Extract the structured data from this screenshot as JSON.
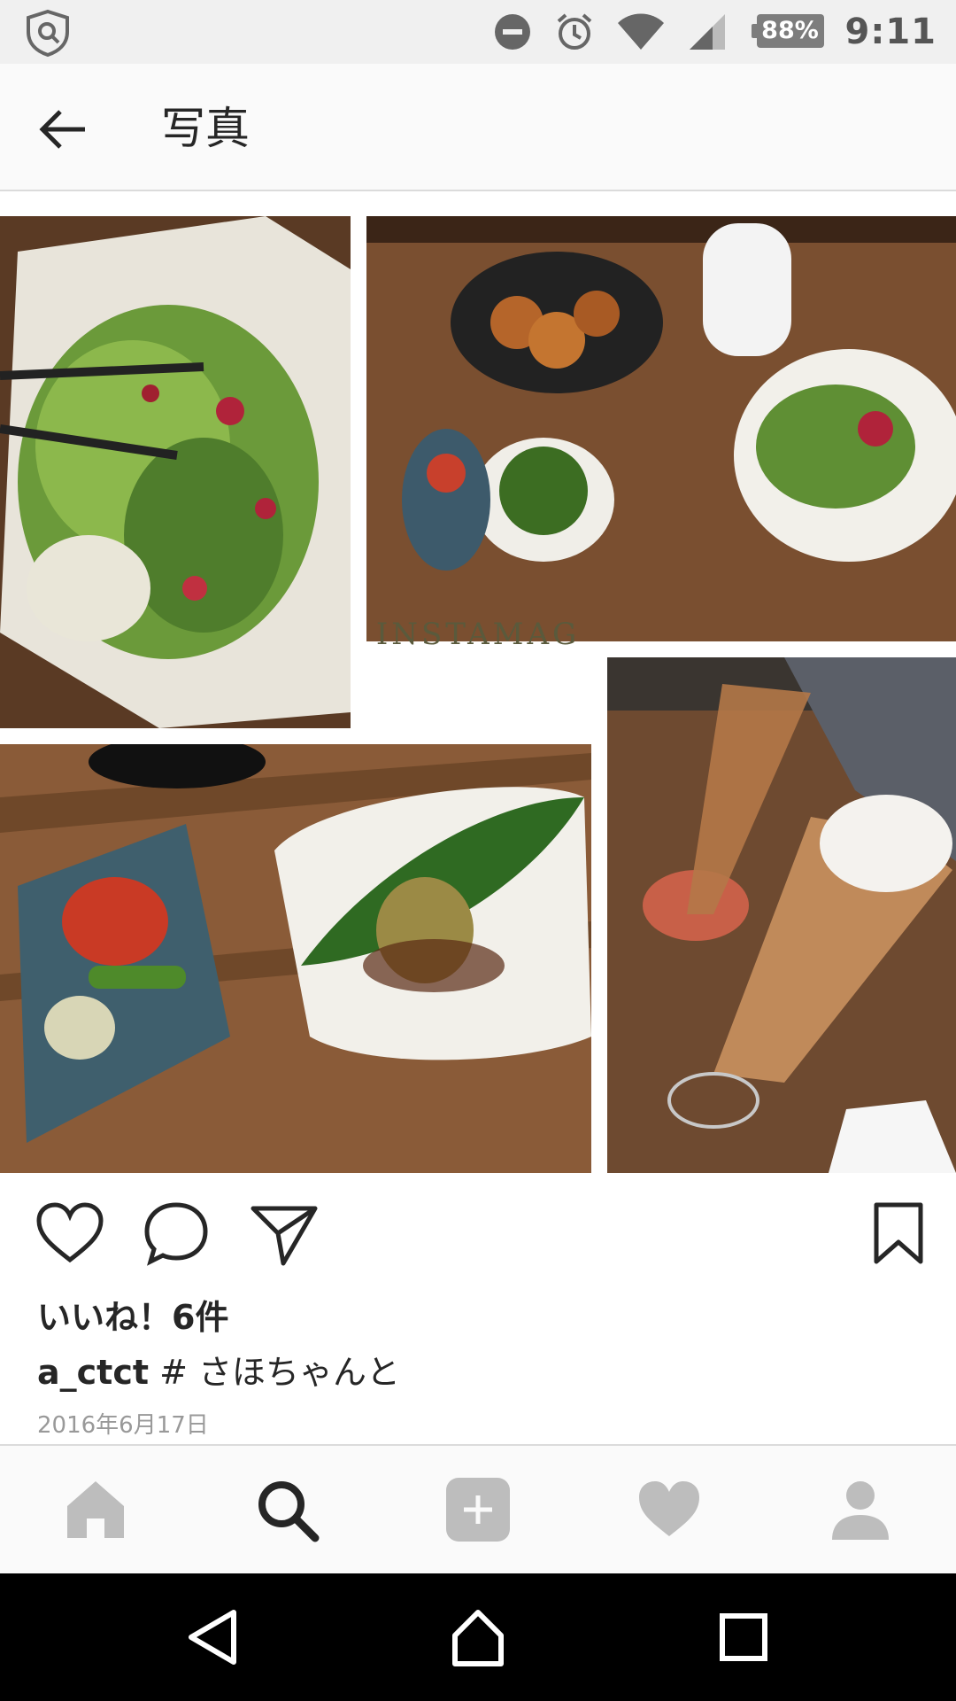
{
  "status_bar": {
    "battery": "88%",
    "time": "9:11",
    "icons": [
      "shield-icon",
      "do-not-disturb-icon",
      "alarm-icon",
      "wifi-icon",
      "signal-icon",
      "battery-icon"
    ]
  },
  "header": {
    "title": "写真",
    "back_icon": "arrow-left-icon"
  },
  "post": {
    "photo_brand": "INSTAMAG",
    "actions": [
      "heart-icon",
      "comment-icon",
      "share-icon",
      "bookmark-icon"
    ],
    "likes": "いいね！6件",
    "username": "a_ctct",
    "caption_text": " # さほちゃんと",
    "date": "2016年6月17日"
  },
  "tab_bar": {
    "items": [
      "home-icon",
      "search-icon",
      "add-icon",
      "activity-heart-icon",
      "profile-icon"
    ],
    "active": "search-icon"
  },
  "nav_bar": {
    "items": [
      "back-triangle-icon",
      "home-nav-icon",
      "recents-icon"
    ]
  }
}
